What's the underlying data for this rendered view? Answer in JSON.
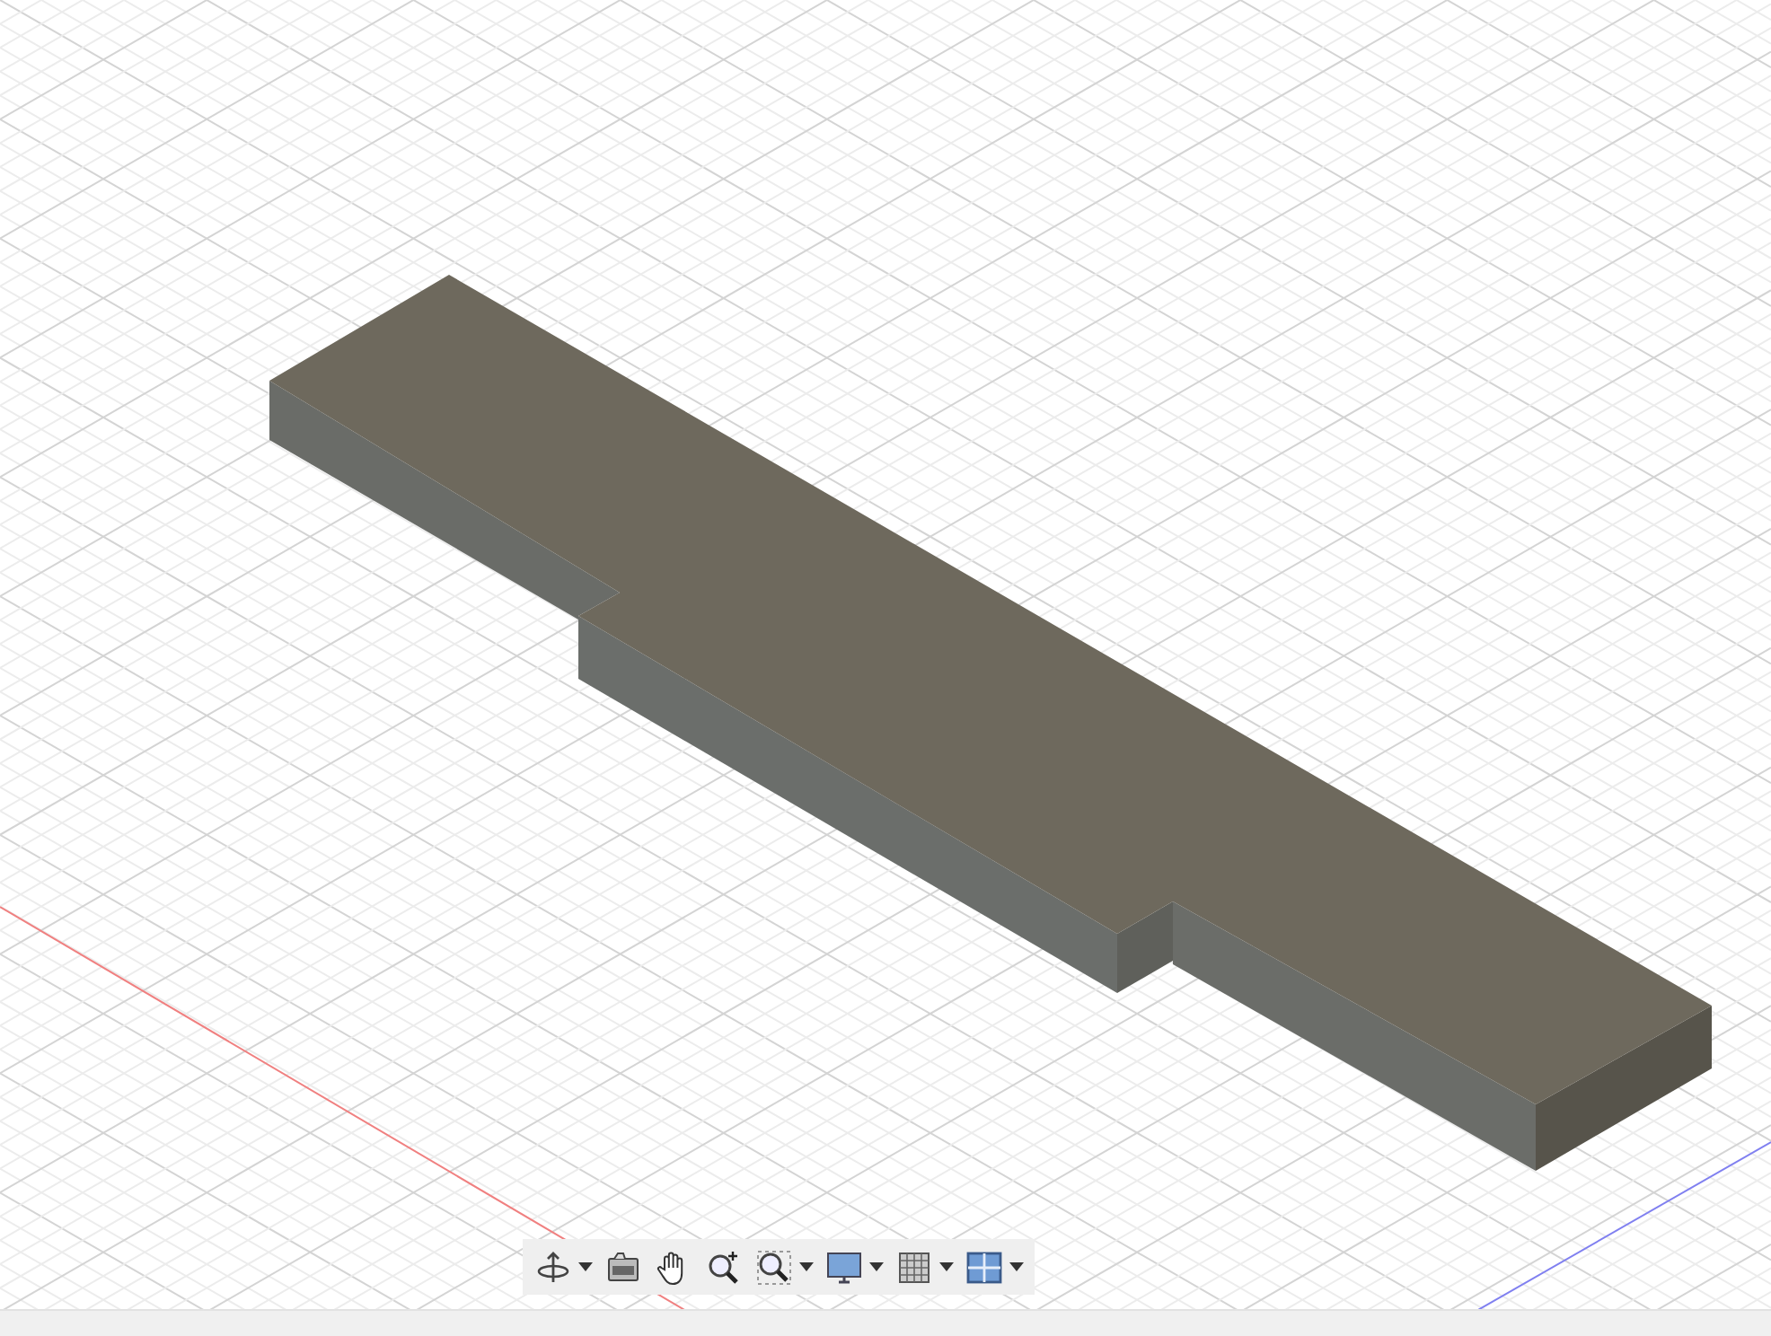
{
  "toolbar": {
    "buttons": [
      {
        "kind": "orbit",
        "dropdown": true
      },
      {
        "kind": "look-at",
        "dropdown": false
      },
      {
        "kind": "pan",
        "dropdown": false
      },
      {
        "kind": "zoom",
        "dropdown": false
      },
      {
        "kind": "fit",
        "dropdown": true
      },
      {
        "kind": "display",
        "dropdown": true
      },
      {
        "kind": "grid",
        "dropdown": true
      },
      {
        "kind": "viewports",
        "dropdown": true
      }
    ]
  }
}
